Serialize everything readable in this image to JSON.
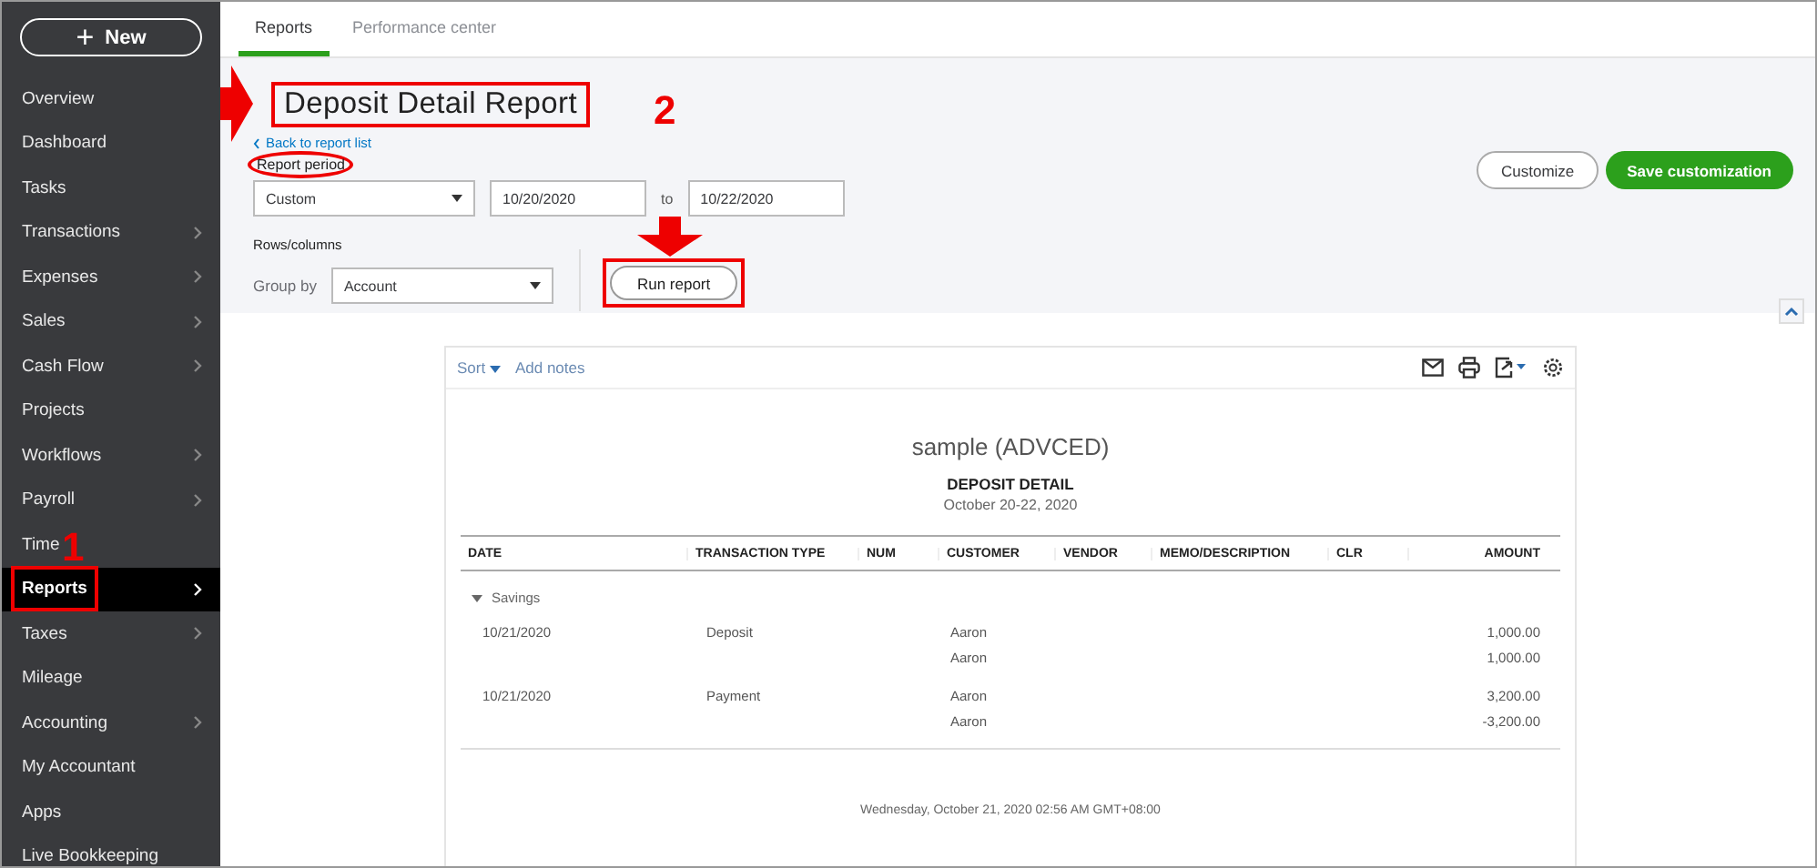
{
  "sidebar": {
    "new_button": {
      "icon": "+",
      "label": "New"
    },
    "items": [
      {
        "label": "Overview",
        "has_submenu": false,
        "selected": false
      },
      {
        "label": "Dashboard",
        "has_submenu": false,
        "selected": false
      },
      {
        "label": "Tasks",
        "has_submenu": false,
        "selected": false
      },
      {
        "label": "Transactions",
        "has_submenu": true,
        "selected": false
      },
      {
        "label": "Expenses",
        "has_submenu": true,
        "selected": false
      },
      {
        "label": "Sales",
        "has_submenu": true,
        "selected": false
      },
      {
        "label": "Cash Flow",
        "has_submenu": true,
        "selected": false
      },
      {
        "label": "Projects",
        "has_submenu": false,
        "selected": false
      },
      {
        "label": "Workflows",
        "has_submenu": true,
        "selected": false
      },
      {
        "label": "Payroll",
        "has_submenu": true,
        "selected": false
      },
      {
        "label": "Time",
        "has_submenu": false,
        "selected": false
      },
      {
        "label": "Reports",
        "has_submenu": true,
        "selected": true,
        "highlighted": true,
        "callout": "1"
      },
      {
        "label": "Taxes",
        "has_submenu": true,
        "selected": false
      },
      {
        "label": "Mileage",
        "has_submenu": false,
        "selected": false
      },
      {
        "label": "Accounting",
        "has_submenu": true,
        "selected": false
      },
      {
        "label": "My Accountant",
        "has_submenu": false,
        "selected": false
      },
      {
        "label": "Apps",
        "has_submenu": false,
        "selected": false
      },
      {
        "label": "Live Bookkeeping",
        "has_submenu": false,
        "selected": false
      }
    ]
  },
  "tabs": [
    {
      "label": "Reports",
      "selected": true
    },
    {
      "label": "Performance center",
      "selected": false
    }
  ],
  "header": {
    "title": "Deposit Detail Report",
    "title_highlighted": true,
    "title_arrow": true,
    "back_link": "Back to report list",
    "report_period": {
      "label": "Report period",
      "highlighted": true,
      "value": "Custom",
      "from": "10/20/2020",
      "to_label": "to",
      "to": "10/22/2020"
    },
    "rows_columns_label": "Rows/columns",
    "group_by": {
      "label": "Group by",
      "value": "Account"
    },
    "run_button": {
      "label": "Run report",
      "highlighted": true,
      "arrow": true,
      "callout": "2"
    },
    "customize_button": "Customize",
    "save_button": "Save customization"
  },
  "report": {
    "toolbar": {
      "sort": "Sort",
      "add_notes": "Add notes"
    },
    "company": "sample (ADVCED)",
    "title": "DEPOSIT DETAIL",
    "period": "October 20-22, 2020",
    "columns": [
      "DATE",
      "TRANSACTION TYPE",
      "NUM",
      "CUSTOMER",
      "VENDOR",
      "MEMO/DESCRIPTION",
      "CLR",
      "AMOUNT"
    ],
    "groups": [
      {
        "name": "Savings",
        "expanded": true,
        "transactions": [
          {
            "date": "10/21/2020",
            "type": "Deposit",
            "lines": [
              {
                "customer": "Aaron",
                "amount": "1,000.00"
              },
              {
                "customer": "Aaron",
                "amount": "1,000.00"
              }
            ]
          },
          {
            "date": "10/21/2020",
            "type": "Payment",
            "lines": [
              {
                "customer": "Aaron",
                "amount": "3,200.00"
              },
              {
                "customer": "Aaron",
                "amount": "-3,200.00"
              }
            ]
          }
        ]
      }
    ],
    "footer": "Wednesday, October 21, 2020   02:56 AM GMT+08:00"
  }
}
